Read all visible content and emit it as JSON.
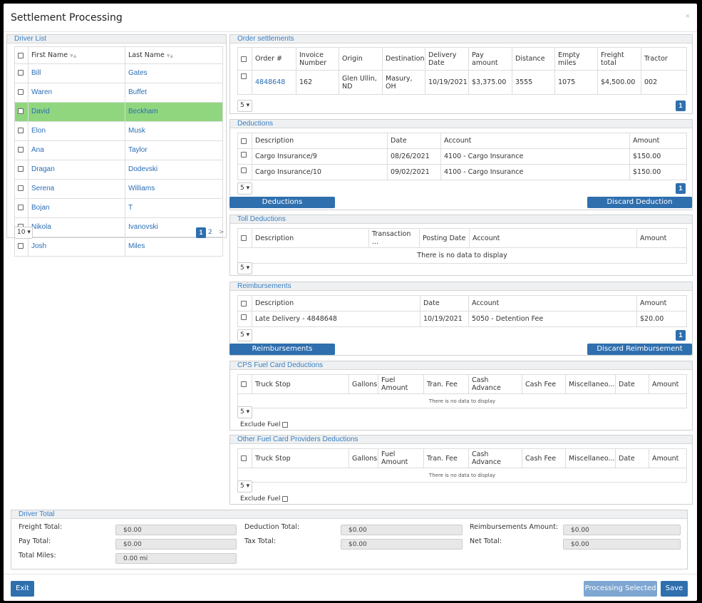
{
  "title": "Settlement Processing",
  "close_glyph": "×",
  "driver_list": {
    "header": "Driver List",
    "columns": [
      "First Name",
      "Last Name"
    ],
    "sort_glyph": "▼▲",
    "rows": [
      {
        "first": "Bill",
        "last": "Gates"
      },
      {
        "first": "Waren",
        "last": "Buffet"
      },
      {
        "first": "David",
        "last": "Beckham",
        "selected": true
      },
      {
        "first": "Elon",
        "last": "Musk"
      },
      {
        "first": "Ana",
        "last": "Taylor"
      },
      {
        "first": "Dragan",
        "last": "Dodevski"
      },
      {
        "first": "Serena",
        "last": "Williams"
      },
      {
        "first": "Bojan",
        "last": "T"
      },
      {
        "first": "Nikola",
        "last": "Ivanovski"
      },
      {
        "first": "Josh",
        "last": "Miles"
      }
    ],
    "page_size": "10",
    "pages": [
      "1",
      "2"
    ],
    "next": ">"
  },
  "order_settlements": {
    "header": "Order settlements",
    "columns": [
      "Order #",
      "Invoice Number",
      "Origin",
      "Destination",
      "Delivery Date",
      "Pay amount",
      "Distance",
      "Empty miles",
      "Freight total",
      "Tractor"
    ],
    "rows": [
      [
        "4848648",
        "162",
        "Glen Ullin, ND",
        "Masury, OH",
        "10/19/2021",
        "$3,375.00",
        "3555",
        "1075",
        "$4,500.00",
        "002"
      ]
    ],
    "page_size": "5",
    "page": "1"
  },
  "deductions": {
    "header": "Deductions",
    "columns": [
      "Description",
      "Date",
      "Account",
      "Amount"
    ],
    "rows": [
      [
        "Cargo Insurance/9",
        "08/26/2021",
        "4100 - Cargo Insurance",
        "$150.00"
      ],
      [
        "Cargo Insurance/10",
        "09/02/2021",
        "4100 - Cargo Insurance",
        "$150.00"
      ]
    ],
    "page_size": "5",
    "page": "1",
    "add_button": "Deductions",
    "discard_button": "Discard Deduction"
  },
  "toll_deductions": {
    "header": "Toll Deductions",
    "columns": [
      "Description",
      "Transaction ...",
      "Posting Date",
      "Account",
      "Amount"
    ],
    "empty": "There is no data to display",
    "page_size": "5"
  },
  "reimbursements": {
    "header": "Reimbursements",
    "columns": [
      "Description",
      "Date",
      "Account",
      "Amount"
    ],
    "rows": [
      [
        "Late Delivery - 4848648",
        "10/19/2021",
        "5050 - Detention Fee",
        "$20.00"
      ]
    ],
    "page_size": "5",
    "page": "1",
    "add_button": "Reimbursements",
    "discard_button": "Discard Reimbursement"
  },
  "cps_fuel": {
    "header": "CPS Fuel Card Deductions",
    "columns": [
      "Truck Stop",
      "Gallons",
      "Fuel Amount",
      "Tran. Fee",
      "Cash Advance",
      "Cash Fee",
      "Miscellaneo...",
      "Date",
      "Amount"
    ],
    "empty": "There is no data to display",
    "page_size": "5",
    "exclude_label": "Exclude Fuel"
  },
  "other_fuel": {
    "header": "Other Fuel Card Providers Deductions",
    "columns": [
      "Truck Stop",
      "Gallons",
      "Fuel Amount",
      "Tran. Fee",
      "Cash Advance",
      "Cash Fee",
      "Miscellaneo...",
      "Date",
      "Amount"
    ],
    "empty": "There is no data to display",
    "page_size": "5",
    "exclude_label": "Exclude Fuel"
  },
  "driver_total": {
    "header": "Driver Total",
    "freight_label": "Freight Total:",
    "freight_value": "$0.00",
    "pay_label": "Pay Total:",
    "pay_value": "$0.00",
    "miles_label": "Total Miles:",
    "miles_value": "0.00 mi",
    "deduction_label": "Deduction Total:",
    "deduction_value": "$0.00",
    "tax_label": "Tax Total:",
    "tax_value": "$0.00",
    "reimb_label": "Reimbursements Amount:",
    "reimb_value": "$0.00",
    "net_label": "Net Total:",
    "net_value": "$0.00"
  },
  "footer": {
    "exit": "Exit",
    "processing": "Processing Selected",
    "save": "Save"
  },
  "colors": {
    "primary": "#2f6fae",
    "selected_row": "#90d67f",
    "link": "#2a6db5",
    "disabled_button": "#7ea6d1"
  }
}
